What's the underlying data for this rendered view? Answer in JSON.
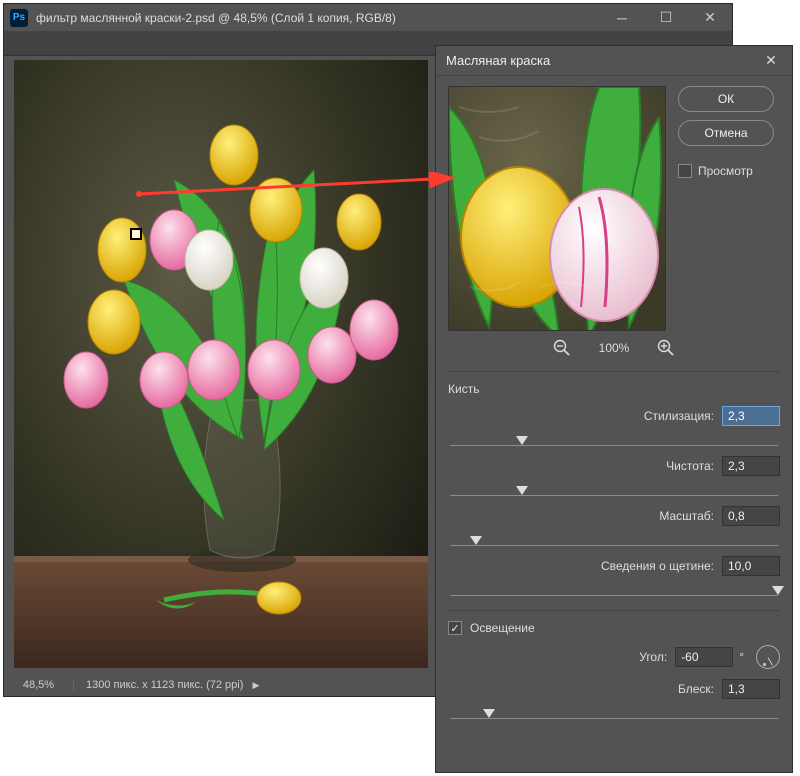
{
  "window": {
    "title": "фильтр маслянной краски-2.psd @ 48,5% (Слой 1 копия, RGB/8)",
    "logo_text": "Ps",
    "zoom": "48,5%",
    "doc_info": "1300 пикс. x 1123 пикс. (72 ppi)"
  },
  "dialog": {
    "title": "Масляная краска",
    "buttons": {
      "ok": "ОК",
      "cancel": "Отмена"
    },
    "preview_checkbox": {
      "label": "Просмотр",
      "checked": false
    },
    "zoom_level": "100%",
    "section_brush": "Кисть",
    "fields": {
      "stylization": {
        "label": "Стилизация:",
        "value": "2,3",
        "thumb_pct": 22
      },
      "cleanliness": {
        "label": "Чистота:",
        "value": "2,3",
        "thumb_pct": 22
      },
      "scale": {
        "label": "Масштаб:",
        "value": "0,8",
        "thumb_pct": 8
      },
      "bristle": {
        "label": "Сведения о щетине:",
        "value": "10,0",
        "thumb_pct": 100
      }
    },
    "section_light": "Освещение",
    "light_checked": true,
    "angle": {
      "label": "Угол:",
      "value": "-60",
      "unit": "°"
    },
    "shine": {
      "label": "Блеск:",
      "value": "1,3",
      "thumb_pct": 12
    }
  }
}
